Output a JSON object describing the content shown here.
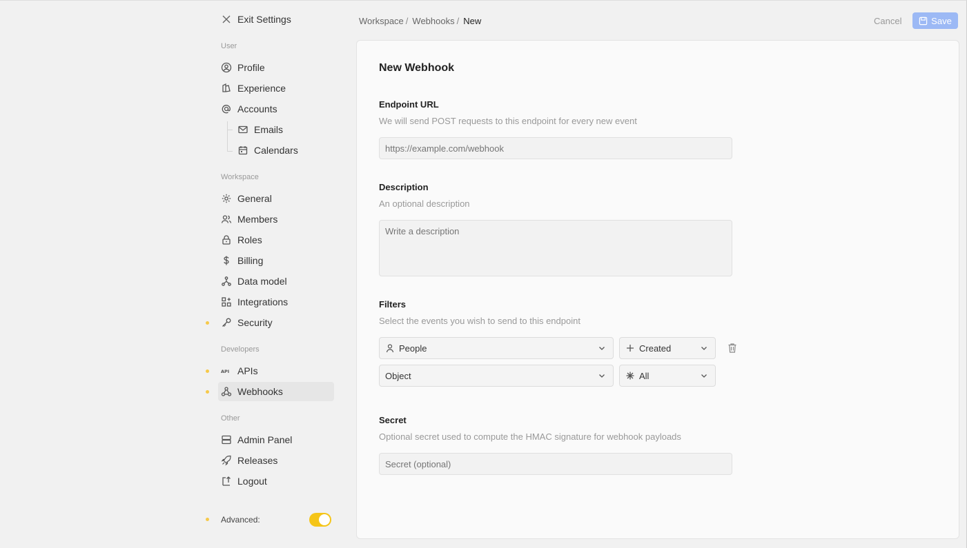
{
  "sidebar": {
    "exit_label": "Exit Settings",
    "sections": {
      "user": "User",
      "workspace": "Workspace",
      "developers": "Developers",
      "other": "Other"
    },
    "items": {
      "profile": "Profile",
      "experience": "Experience",
      "accounts": "Accounts",
      "emails": "Emails",
      "calendars": "Calendars",
      "general": "General",
      "members": "Members",
      "roles": "Roles",
      "billing": "Billing",
      "data_model": "Data model",
      "integrations": "Integrations",
      "security": "Security",
      "apis": "APIs",
      "webhooks": "Webhooks",
      "admin_panel": "Admin Panel",
      "releases": "Releases",
      "logout": "Logout"
    },
    "advanced_label": "Advanced:",
    "advanced_on": true
  },
  "header": {
    "breadcrumb": [
      "Workspace",
      "Webhooks",
      "New"
    ],
    "separator": "/",
    "cancel_label": "Cancel",
    "save_label": "Save"
  },
  "form": {
    "title": "New Webhook",
    "endpoint": {
      "label": "Endpoint URL",
      "help": "We will send POST requests to this endpoint for every new event",
      "placeholder": "https://example.com/webhook",
      "value": ""
    },
    "description": {
      "label": "Description",
      "help": "An optional description",
      "placeholder": "Write a description",
      "value": ""
    },
    "filters": {
      "label": "Filters",
      "help": "Select the events you wish to send to this endpoint",
      "rows": [
        {
          "object": "People",
          "object_icon": "person-icon",
          "action": "Created",
          "action_icon": "plus-icon"
        },
        {
          "object": "Object",
          "object_icon": "",
          "action": "All",
          "action_icon": "asterisk-icon"
        }
      ]
    },
    "secret": {
      "label": "Secret",
      "help": "Optional secret used to compute the HMAC signature for webhook payloads",
      "placeholder": "Secret (optional)",
      "value": ""
    }
  },
  "colors": {
    "accent": "#9cb9f5",
    "toggle": "#f5c518",
    "indicator_dot": "#f6c94a"
  }
}
